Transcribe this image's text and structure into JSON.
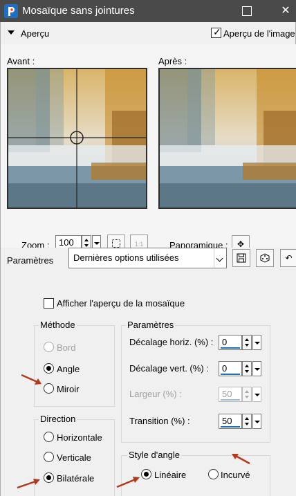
{
  "window": {
    "title": "Mosaïque sans jointures",
    "help_glyph": "?",
    "close_glyph": "✕"
  },
  "preview": {
    "section_label": "Aperçu",
    "show_preview_label": "Aperçu de l'image",
    "show_preview_checked": true,
    "before_label": "Avant :",
    "after_label": "Après :",
    "zoom_label": "Zoom :",
    "zoom_value": "100",
    "pan_label": "Panoramique :"
  },
  "presets": {
    "label": "Paramètres",
    "selected": "Dernières options utilisées"
  },
  "mosaic_preview": {
    "label": "Afficher l'aperçu de la mosaïque",
    "checked": false
  },
  "method": {
    "title": "Méthode",
    "options": [
      {
        "label": "Bord",
        "selected": false,
        "enabled": false
      },
      {
        "label": "Angle",
        "selected": true,
        "enabled": true
      },
      {
        "label": "Miroir",
        "selected": false,
        "enabled": true
      }
    ]
  },
  "direction": {
    "title": "Direction",
    "options": [
      {
        "label": "Horizontale",
        "selected": false
      },
      {
        "label": "Verticale",
        "selected": false
      },
      {
        "label": "Bilatérale",
        "selected": true
      }
    ]
  },
  "parameters": {
    "title": "Paramètres",
    "h_offset_label": "Décalage horiz. (%) :",
    "h_offset_value": "0",
    "v_offset_label": "Décalage vert. (%) :",
    "v_offset_value": "0",
    "width_label": "Largeur (%) :",
    "width_value": "50",
    "transition_label": "Transition (%) :",
    "transition_value": "50"
  },
  "corner_style": {
    "title": "Style d'angle",
    "options": [
      {
        "label": "Linéaire",
        "selected": true
      },
      {
        "label": "Incurvé",
        "selected": false
      }
    ]
  },
  "colors": {
    "titlebar": "#4a4a4a",
    "accent": "#1e6fc0",
    "annotation_arrow": "#b03a1e"
  }
}
